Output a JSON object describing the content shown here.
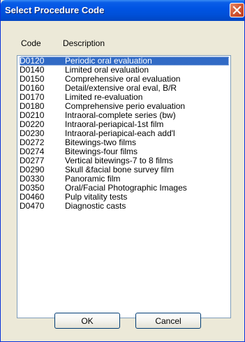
{
  "dialog": {
    "title": "Select Procedure Code",
    "close_icon": "close-icon"
  },
  "list": {
    "columns": {
      "code": "Code",
      "description": "Description"
    },
    "selected_index": 0,
    "rows": [
      {
        "code": "D0120",
        "description": "Periodic oral evaluation"
      },
      {
        "code": "D0140",
        "description": "Limited oral evaluation"
      },
      {
        "code": "D0150",
        "description": "Comprehensive oral evaluation"
      },
      {
        "code": "D0160",
        "description": "Detail/extensive oral eval, B/R"
      },
      {
        "code": "D0170",
        "description": "Limited re-evaluation"
      },
      {
        "code": "D0180",
        "description": "Comprehensive perio evaluation"
      },
      {
        "code": "D0210",
        "description": "Intraoral-complete series (bw)"
      },
      {
        "code": "D0220",
        "description": "Intraoral-periapical-1st film"
      },
      {
        "code": "D0230",
        "description": "Intraoral-periapical-each add'l"
      },
      {
        "code": "D0272",
        "description": "Bitewings-two films"
      },
      {
        "code": "D0274",
        "description": "Bitewings-four films"
      },
      {
        "code": "D0277",
        "description": "Vertical bitewings-7 to 8 films"
      },
      {
        "code": "D0290",
        "description": "Skull &facial bone survey film"
      },
      {
        "code": "D0330",
        "description": "Panoramic film"
      },
      {
        "code": "D0350",
        "description": "Oral/Facial Photographic Images"
      },
      {
        "code": "D0460",
        "description": "Pulp vitality tests"
      },
      {
        "code": "D0470",
        "description": "Diagnostic casts"
      }
    ]
  },
  "buttons": {
    "ok": "OK",
    "cancel": "Cancel"
  },
  "colors": {
    "titlebar": "#0054e3",
    "selection": "#316ac5",
    "close": "#d45a36",
    "dialog_bg": "#ece9d8"
  }
}
